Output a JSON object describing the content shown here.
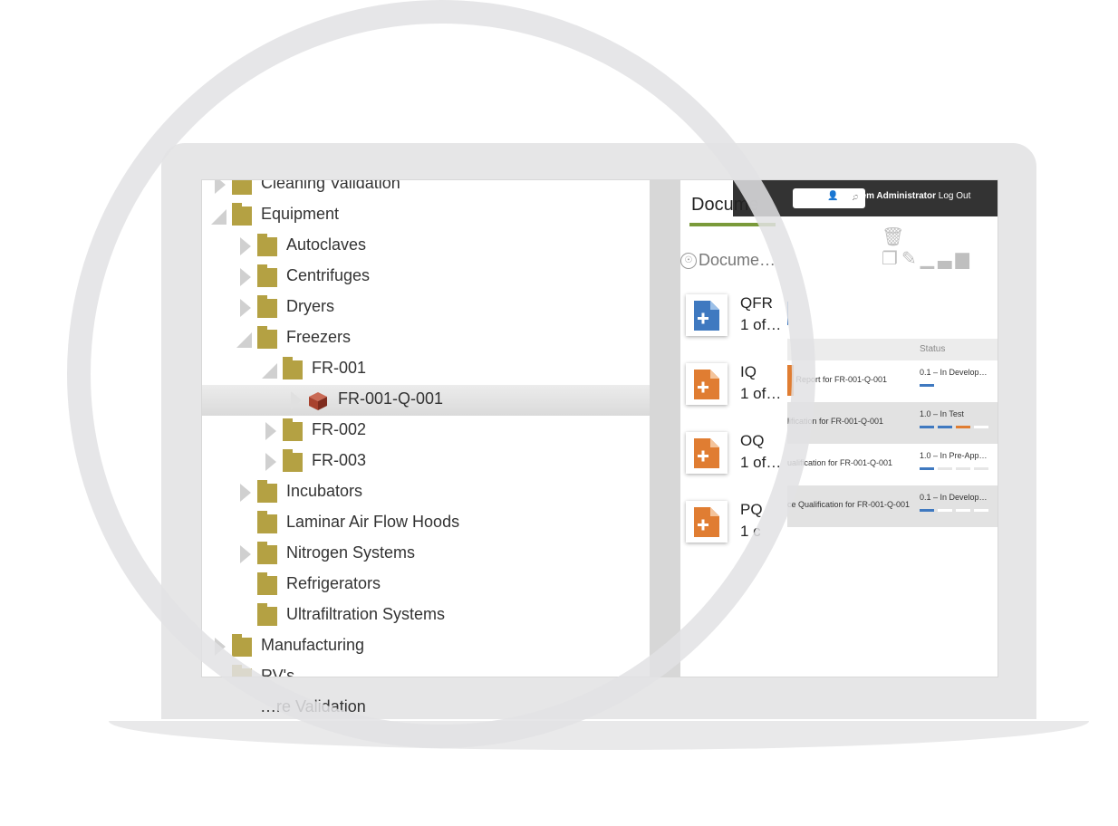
{
  "tree": {
    "items": [
      {
        "label": "Cleaning Validation",
        "expanded": false
      },
      {
        "label": "Equipment",
        "expanded": true
      },
      {
        "label": "Autoclaves",
        "expanded": false
      },
      {
        "label": "Centrifuges",
        "expanded": false
      },
      {
        "label": "Dryers",
        "expanded": false
      },
      {
        "label": "Freezers",
        "expanded": true
      },
      {
        "label": "FR-001",
        "expanded": true
      },
      {
        "label": "FR-001-Q-001",
        "selected": true
      },
      {
        "label": "FR-002",
        "expanded": false
      },
      {
        "label": "FR-003",
        "expanded": false
      },
      {
        "label": "Incubators",
        "expanded": false
      },
      {
        "label": "Laminar Air Flow Hoods"
      },
      {
        "label": "Nitrogen Systems",
        "expanded": false
      },
      {
        "label": "Refrigerators"
      },
      {
        "label": "Ultrafiltration Systems"
      },
      {
        "label": "Manufacturing",
        "expanded": false
      },
      {
        "label": "RV's"
      },
      {
        "label": "…re Validation"
      }
    ]
  },
  "header": {
    "title": "Docume",
    "user_name": "System Administrator",
    "logout": "Log Out"
  },
  "breadcrumb": "Docume…",
  "cards": [
    {
      "title": "QFR",
      "sub": "1 of…",
      "color": "#3f79c0"
    },
    {
      "title": "IQ",
      "sub": "1 of…",
      "color": "#e07d32"
    },
    {
      "title": "OQ",
      "sub": "1 of…",
      "color": "#e07d32"
    },
    {
      "title": "PQ",
      "sub": "1 c",
      "color": "#e07d32"
    }
  ],
  "table": {
    "status_header": "Status",
    "rows": [
      {
        "name": "al Report for FR-001-Q-001",
        "status": "0.1 – In Develop…"
      },
      {
        "name": "lification for FR-001-Q-001",
        "status": "1.0 – In Test"
      },
      {
        "name": "ualification for FR-001-Q-001",
        "status": "1.0 – In Pre-App…"
      },
      {
        "name": "ce Qualification for FR-001-Q-001",
        "status": "0.1 – In Develop…"
      }
    ]
  },
  "colors": {
    "folder": "#b4a143",
    "accent_green": "#7a9a3a",
    "blue": "#3f79c0",
    "orange": "#e07d32",
    "topbar": "#333333"
  }
}
